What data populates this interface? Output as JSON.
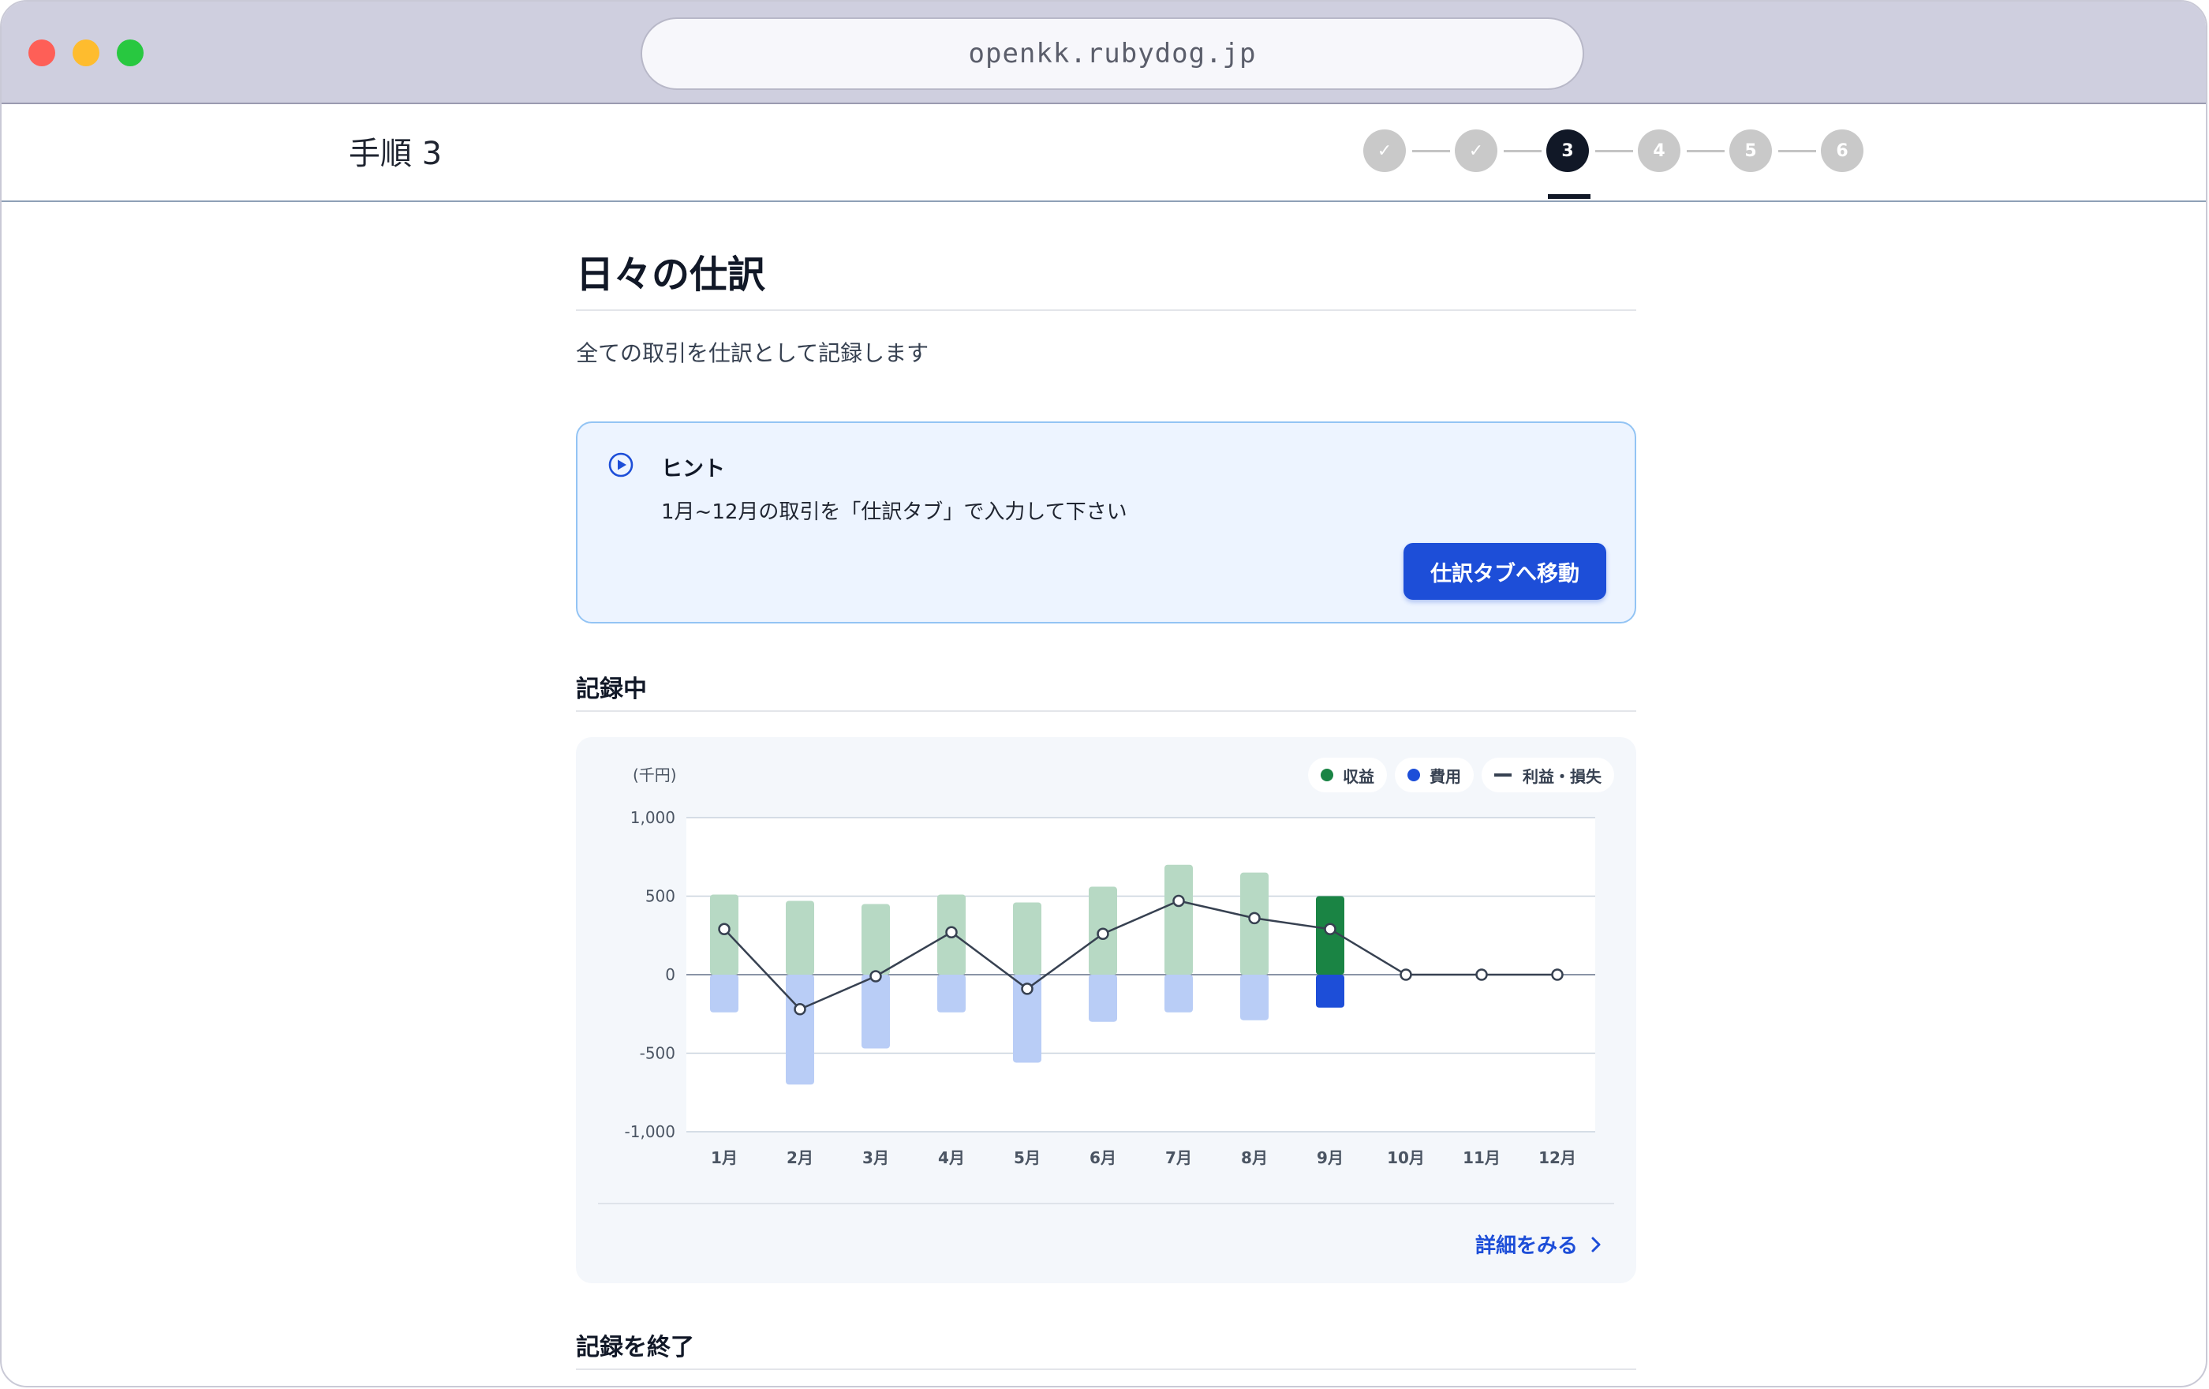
{
  "browser": {
    "url": "openkk.rubydog.jp"
  },
  "header": {
    "step_title": "手順 3",
    "steps": [
      {
        "label": "✓",
        "state": "done"
      },
      {
        "label": "✓",
        "state": "done"
      },
      {
        "label": "3",
        "state": "active"
      },
      {
        "label": "4",
        "state": "todo"
      },
      {
        "label": "5",
        "state": "todo"
      },
      {
        "label": "6",
        "state": "todo"
      }
    ]
  },
  "page": {
    "title": "日々の仕訳",
    "subtitle": "全ての取引を仕訳として記録します"
  },
  "hint": {
    "title": "ヒント",
    "text": "1月~12月の取引を「仕訳タブ」で入力して下さい",
    "button_label": "仕訳タブへ移動"
  },
  "recording": {
    "section_title": "記録中",
    "details_link": "詳細をみる",
    "end_section_title": "記録を終了"
  },
  "colors": {
    "revenue": "#1a8444",
    "revenue_light": "#b7d9c4",
    "expense": "#1d4ed8",
    "expense_light": "#b9cdf6",
    "profit_line": "#374151"
  },
  "chart_data": {
    "type": "bar",
    "unit_label": "(千円)",
    "categories": [
      "1月",
      "2月",
      "3月",
      "4月",
      "5月",
      "6月",
      "7月",
      "8月",
      "9月",
      "10月",
      "11月",
      "12月"
    ],
    "ylim": [
      -1000,
      1000
    ],
    "yticks": [
      1000,
      500,
      0,
      -500,
      -1000
    ],
    "ytick_labels": [
      "1,000",
      "500",
      "0",
      "-500",
      "-1,000"
    ],
    "highlight_index": 8,
    "legend": [
      "収益",
      "費用",
      "利益・損失"
    ],
    "series": [
      {
        "name": "収益",
        "type": "bar",
        "values": [
          510,
          470,
          450,
          510,
          460,
          560,
          700,
          650,
          500,
          0,
          0,
          0
        ]
      },
      {
        "name": "費用",
        "type": "bar",
        "values": [
          -240,
          -700,
          -470,
          -240,
          -560,
          -300,
          -240,
          -290,
          -210,
          0,
          0,
          0
        ]
      },
      {
        "name": "利益・損失",
        "type": "line",
        "values": [
          290,
          -220,
          -10,
          270,
          -90,
          260,
          470,
          360,
          290,
          0,
          0,
          0
        ]
      }
    ],
    "grid": true
  }
}
